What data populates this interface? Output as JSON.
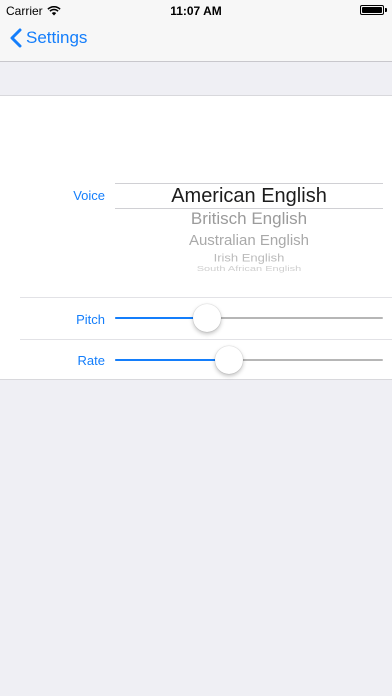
{
  "status_bar": {
    "carrier": "Carrier",
    "time": "11:07 AM"
  },
  "nav": {
    "back_label": "Settings"
  },
  "voice": {
    "label": "Voice",
    "options": [
      "American English",
      "Britisch English",
      "Australian English",
      "Irish English",
      "South African English"
    ],
    "selected": "American English"
  },
  "pitch": {
    "label": "Pitch",
    "value": 0.345
  },
  "rate": {
    "label": "Rate",
    "value": 0.425
  },
  "colors": {
    "accent": "#147efb",
    "background": "#efeff4"
  }
}
